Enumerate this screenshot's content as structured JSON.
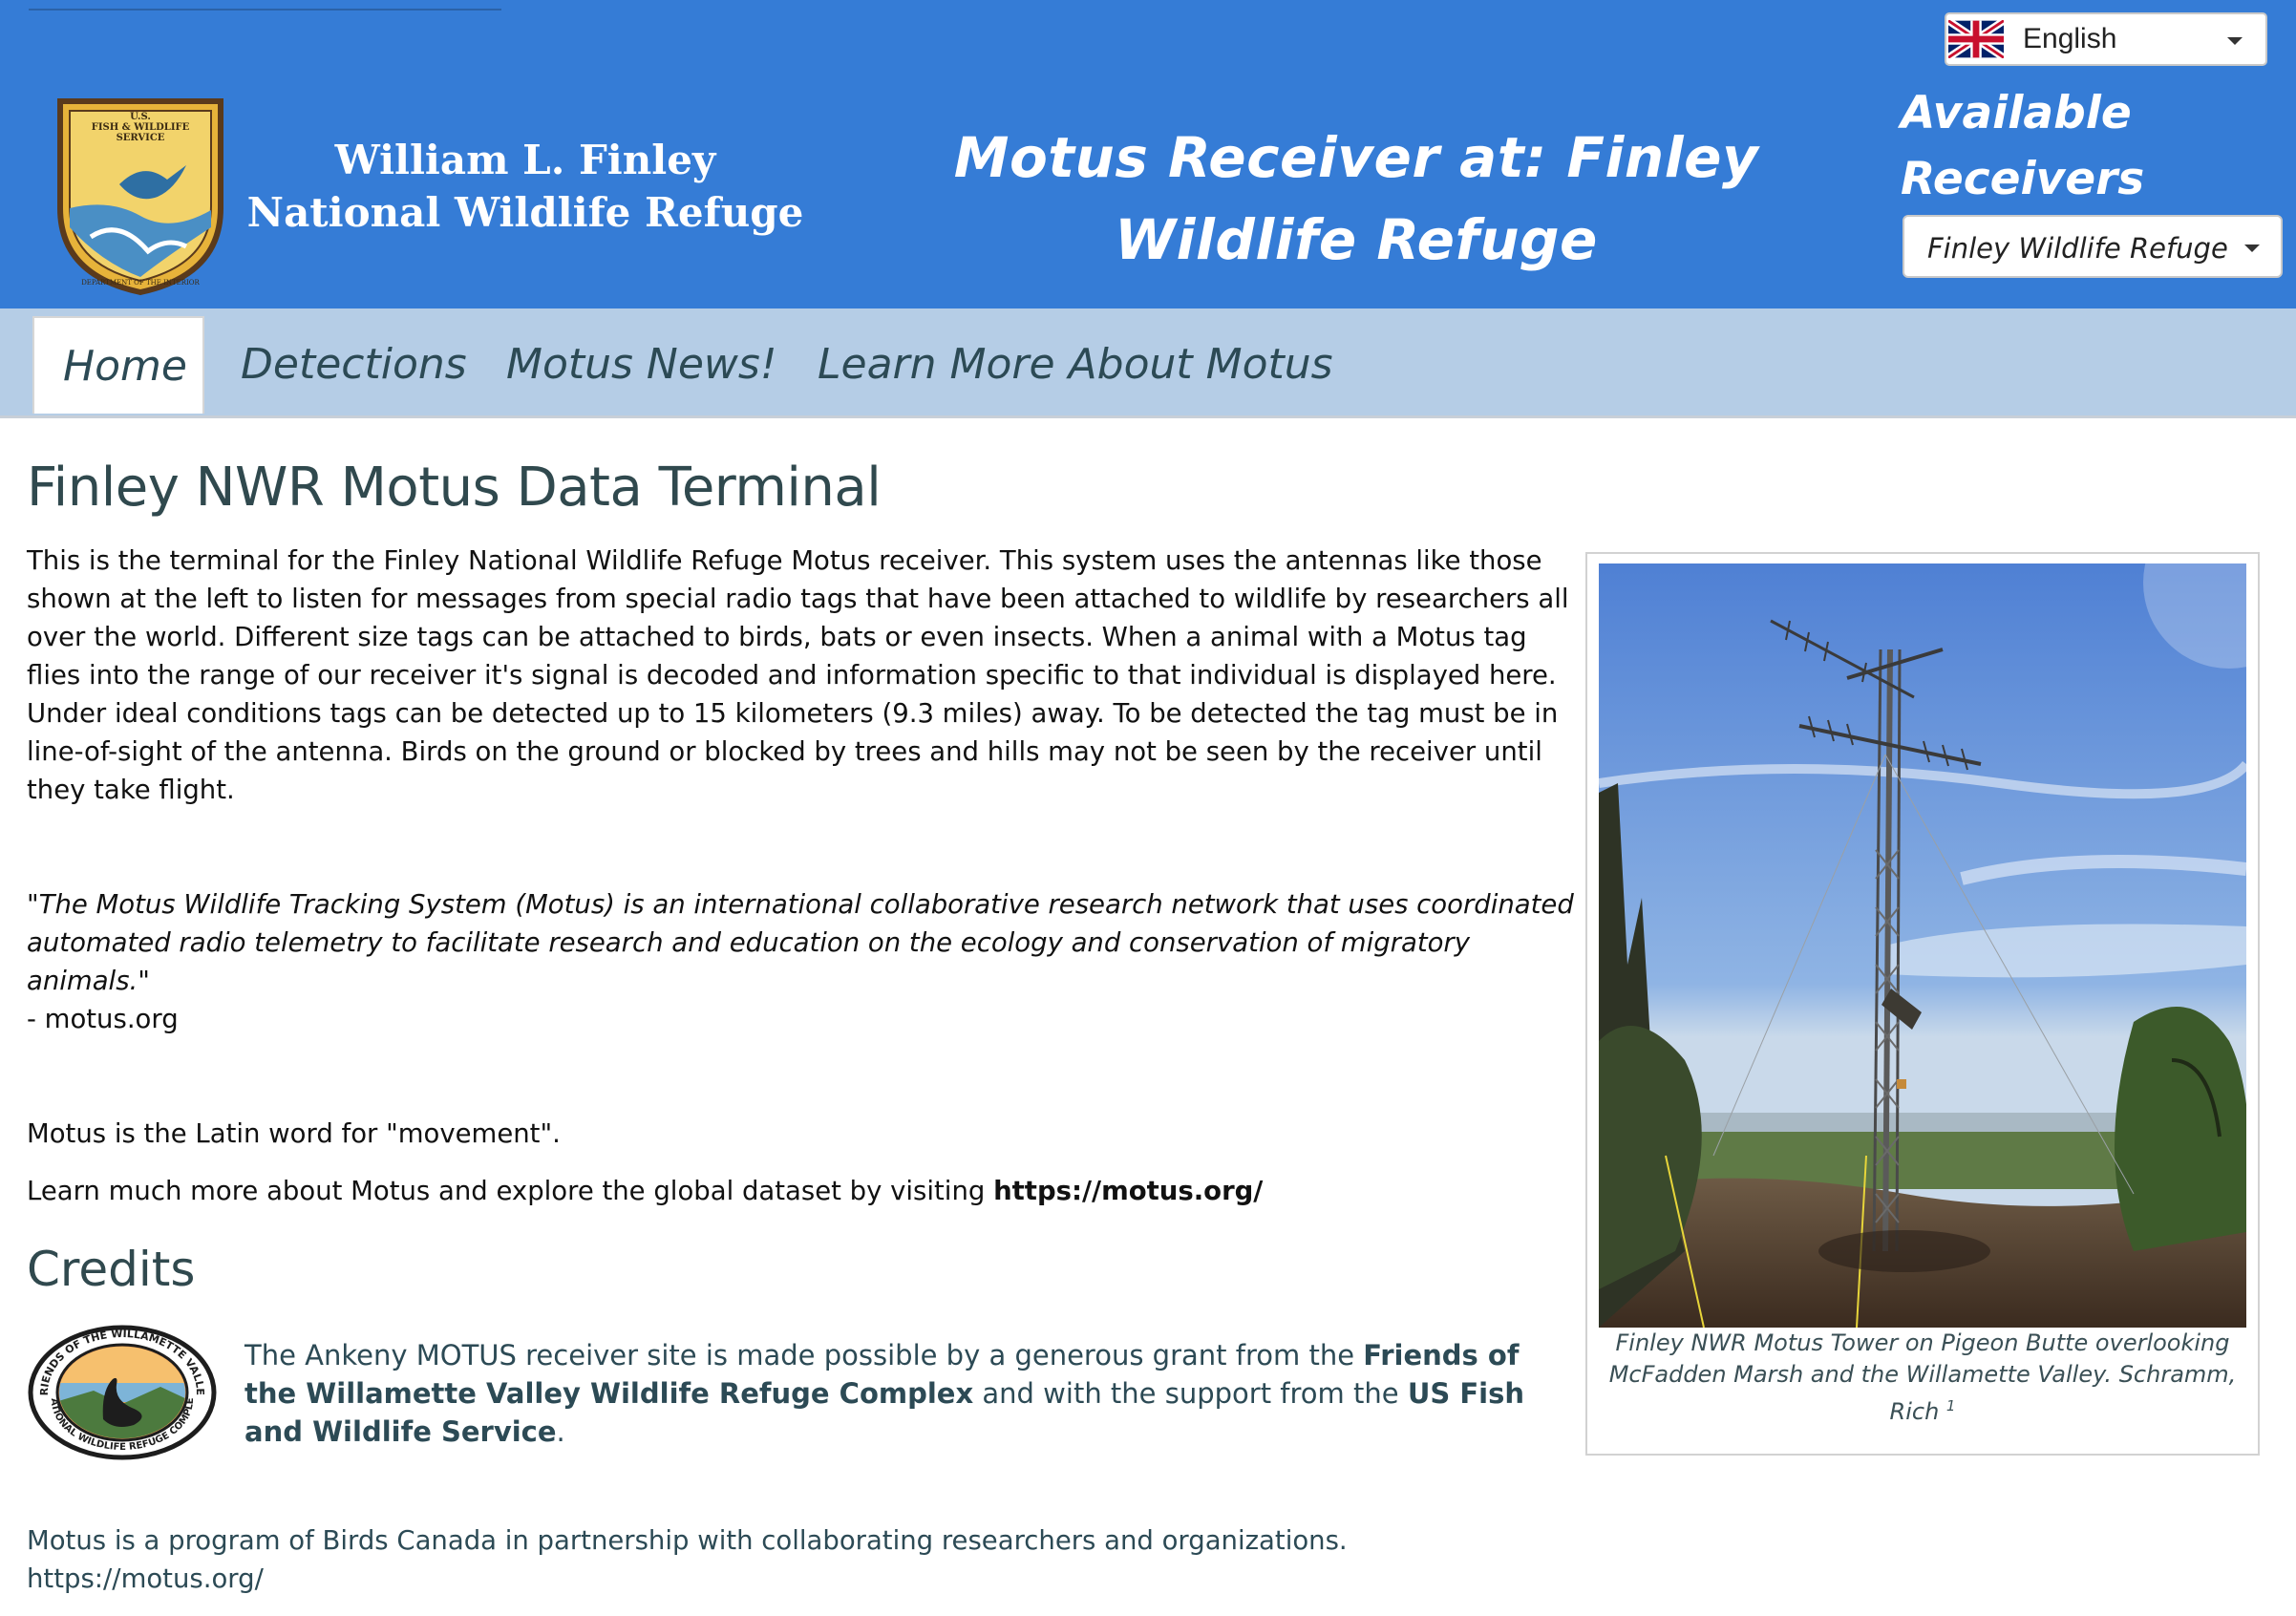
{
  "colors": {
    "header_bg": "#357cd6",
    "nav_bg": "#b5cde6",
    "heading_text": "#30494e",
    "nav_text": "#2c4a55"
  },
  "header": {
    "language": "English",
    "refuge_name": "William L. Finley National Wildlife Refuge",
    "site_title": "Motus Receiver at: Finley Wildlife Refuge",
    "receivers_heading": "Available Receivers",
    "receiver_selected": "Finley Wildlife Refuge",
    "icons": [
      "uk-flag-icon",
      "chevron-down-icon",
      "fws-shield-logo"
    ]
  },
  "nav": {
    "items": [
      {
        "label": "Home",
        "active": true
      },
      {
        "label": "Detections",
        "active": false
      },
      {
        "label": "Motus News!",
        "active": false
      },
      {
        "label": "Learn More About Motus",
        "active": false
      }
    ]
  },
  "main": {
    "title": "Finley NWR Motus Data Terminal",
    "intro": "This is the terminal for the Finley National Wildlife Refuge Motus receiver. This system uses the antennas like those shown at the left to listen for messages from special radio tags that have been attached to wildlife by researchers all over the world. Different size tags can be attached to birds, bats or even insects. When a animal with a Motus tag flies into the range of our receiver it's signal is decoded and information specific to that individual is displayed here. Under ideal conditions tags can be detected up to 15 kilometers (9.3 miles) away. To be detected the tag must be in line-of-sight of the antenna. Birds on the ground or blocked by trees and hills may not be seen by the receiver until they take flight.",
    "quote": "\"The Motus Wildlife Tracking System (Motus) is an international collaborative research network that uses coordinated automated radio telemetry to facilitate research and education on the ecology and conservation of migratory animals.\"",
    "quote_source": "- motus.org",
    "latin": "Motus is the Latin word for \"movement\".",
    "learn_more_prefix": "Learn much more about Motus and explore the global dataset by visiting ",
    "learn_more_link": "https://motus.org/"
  },
  "credits": {
    "title": "Credits",
    "text_1": "The Ankeny MOTUS receiver site is made possible by a generous grant from the ",
    "bold_1": "Friends of the Willamette Valley Wildlife Refuge Complex",
    "text_2": " and with the support from the ",
    "bold_2": "US Fish and Wildlife Service",
    "text_3": ".",
    "logo_text_top": "FRIENDS OF THE WILLAMETTE VALLEY",
    "logo_text_bottom": "NATIONAL WILDLIFE REFUGE COMPLEX"
  },
  "footer": {
    "line_1": "Motus is a program of Birds Canada in partnership with collaborating researchers and organizations.",
    "line_2": "https://motus.org/"
  },
  "figure": {
    "caption": "Finley NWR Motus Tower on Pigeon Butte overlooking McFadden Marsh and the Willamette Valley. Schramm, Rich",
    "caption_sup": "1"
  },
  "logo_fws": {
    "top_text_1": "U.S.",
    "top_text_2": "FISH & WILDLIFE",
    "top_text_3": "SERVICE",
    "bottom_text": "DEPARTMENT OF THE INTERIOR"
  }
}
